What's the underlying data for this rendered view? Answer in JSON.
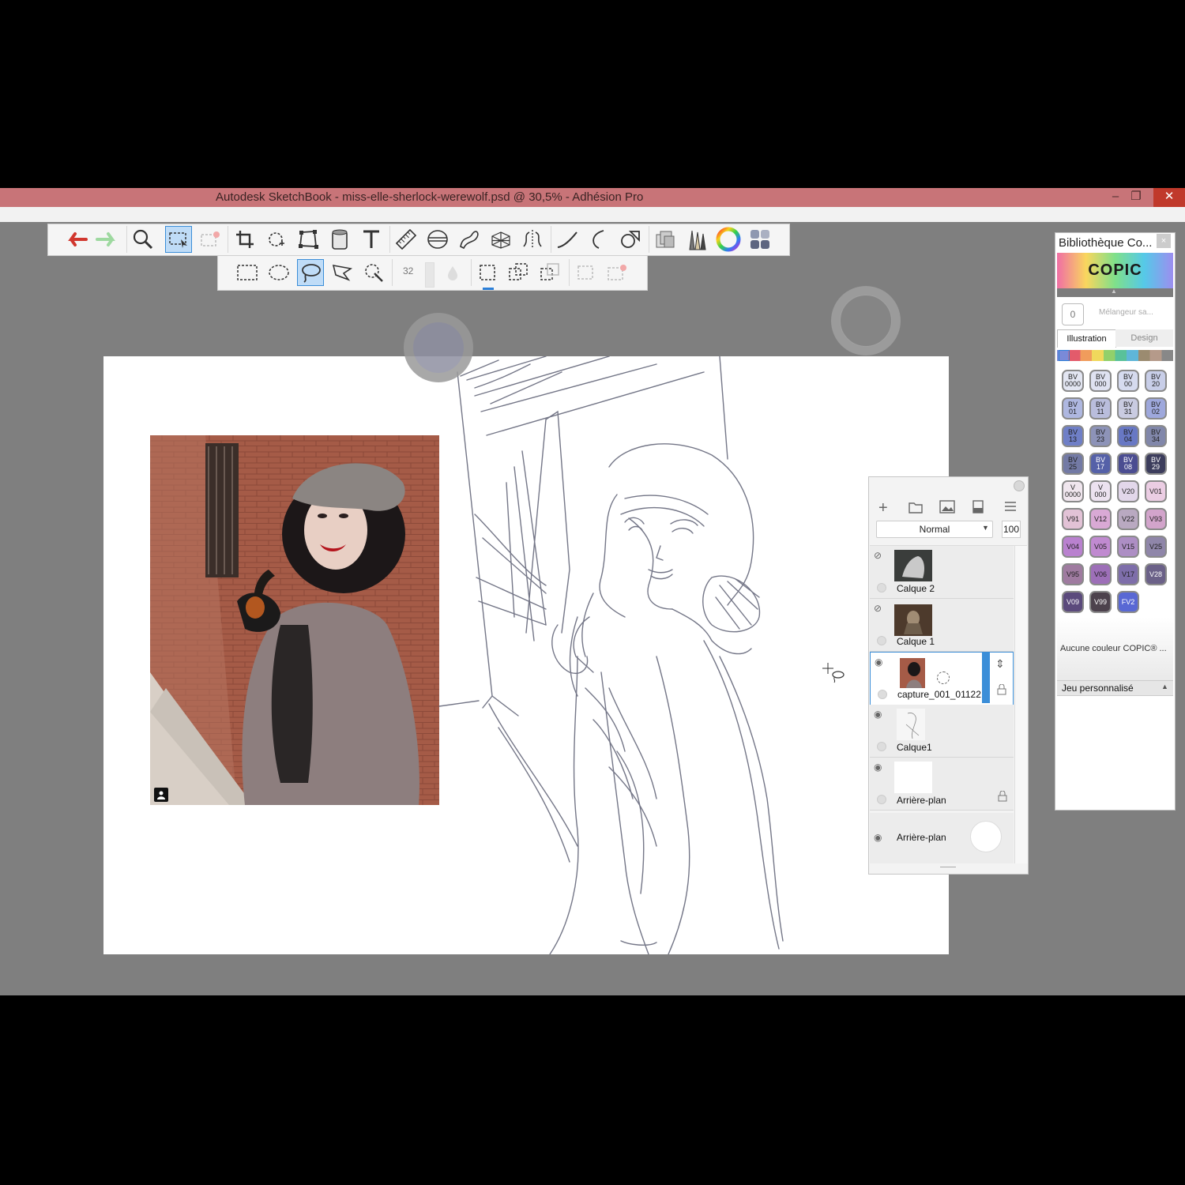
{
  "window": {
    "title": "Autodesk SketchBook - miss-elle-sherlock-werewolf.psd @ 30,5% - Adhésion Pro",
    "minimize": "–",
    "restore": "❐",
    "close": "✕"
  },
  "toolbar_main": {
    "tools": [
      "undo-icon",
      "redo-icon",
      "zoom-icon",
      "select-icon",
      "transform-select-icon",
      "crop-icon",
      "move-rotate-icon",
      "distort-icon",
      "fill-bucket-icon",
      "text-icon",
      "ruler-icon",
      "ellipse-guide-icon",
      "french-curve-icon",
      "perspective-icon",
      "symmetry-icon",
      "stroke-icon",
      "predictive-stroke-icon",
      "shape-icon",
      "layer-copy-icon",
      "brushes-icon",
      "color-wheel-icon",
      "copic-library-icon"
    ]
  },
  "toolbar_sub": {
    "brush_size": "32",
    "tools": [
      "rect-select-icon",
      "oval-select-icon",
      "lasso-select-icon",
      "polyline-lasso-icon",
      "magic-wand-icon"
    ]
  },
  "reference_photo": {
    "badge_icon": "user-icon"
  },
  "layers": {
    "blend_mode": "Normal",
    "opacity": "100",
    "items": [
      {
        "name": "Calque 2",
        "visible": false
      },
      {
        "name": "Calque 1",
        "visible": false
      },
      {
        "name": "capture_001_01122...",
        "visible": true,
        "selected": true
      },
      {
        "name": "Calque1",
        "visible": true
      },
      {
        "name": "Arrière-plan",
        "visible": true
      }
    ],
    "background_label": "Arrière-plan"
  },
  "copic": {
    "title": "Bibliothèque Co...",
    "logo": "COPIC",
    "mixer_value": "0",
    "mixer_label": "Mélangeur sa...",
    "tabs": [
      "Illustration",
      "Design"
    ],
    "no_color": "Aucune couleur COPIC® ...",
    "custom_set": "Jeu personnalisé",
    "swatches": [
      {
        "l1": "BV",
        "l2": "0000",
        "c": "#e3e6f2"
      },
      {
        "l1": "BV",
        "l2": "000",
        "c": "#dfe2f1"
      },
      {
        "l1": "BV",
        "l2": "00",
        "c": "#d6dbef"
      },
      {
        "l1": "BV",
        "l2": "20",
        "c": "#c8cee8"
      },
      {
        "l1": "BV",
        "l2": "01",
        "c": "#aeb7e0"
      },
      {
        "l1": "BV",
        "l2": "11",
        "c": "#b9bddc"
      },
      {
        "l1": "BV",
        "l2": "31",
        "c": "#c9cbe1"
      },
      {
        "l1": "BV",
        "l2": "02",
        "c": "#9ea8dc"
      },
      {
        "l1": "BV",
        "l2": "13",
        "c": "#6f7fc7"
      },
      {
        "l1": "BV",
        "l2": "23",
        "c": "#8d93b8"
      },
      {
        "l1": "BV",
        "l2": "04",
        "c": "#6878c4"
      },
      {
        "l1": "BV",
        "l2": "34",
        "c": "#8187aa"
      },
      {
        "l1": "BV",
        "l2": "25",
        "c": "#737aa5"
      },
      {
        "l1": "BV",
        "l2": "17",
        "c": "#5561a8"
      },
      {
        "l1": "BV",
        "l2": "08",
        "c": "#4b4d91"
      },
      {
        "l1": "BV",
        "l2": "29",
        "c": "#3c3d5c"
      },
      {
        "l1": "V",
        "l2": "0000",
        "c": "#f0e6ee"
      },
      {
        "l1": "V",
        "l2": "000",
        "c": "#ece2f0"
      },
      {
        "l1": "V20",
        "l2": "",
        "c": "#e2d7ea"
      },
      {
        "l1": "V01",
        "l2": "",
        "c": "#ebcde3"
      },
      {
        "l1": "V91",
        "l2": "",
        "c": "#e2c2d6"
      },
      {
        "l1": "V12",
        "l2": "",
        "c": "#d9a9d5"
      },
      {
        "l1": "V22",
        "l2": "",
        "c": "#b9a9c1"
      },
      {
        "l1": "V93",
        "l2": "",
        "c": "#d2a4cb"
      },
      {
        "l1": "V04",
        "l2": "",
        "c": "#b981cf"
      },
      {
        "l1": "V05",
        "l2": "",
        "c": "#c08ad0"
      },
      {
        "l1": "V15",
        "l2": "",
        "c": "#ad8ec4"
      },
      {
        "l1": "V25",
        "l2": "",
        "c": "#8f86a9"
      },
      {
        "l1": "V95",
        "l2": "",
        "c": "#9f7ba0"
      },
      {
        "l1": "V06",
        "l2": "",
        "c": "#9d6fb8"
      },
      {
        "l1": "V17",
        "l2": "",
        "c": "#7e6eaa"
      },
      {
        "l1": "V28",
        "l2": "",
        "c": "#6b6188"
      },
      {
        "l1": "V09",
        "l2": "",
        "c": "#5b4a7c"
      },
      {
        "l1": "V99",
        "l2": "",
        "c": "#4d424d"
      },
      {
        "l1": "FV2",
        "l2": "",
        "c": "#5968d4"
      }
    ]
  }
}
